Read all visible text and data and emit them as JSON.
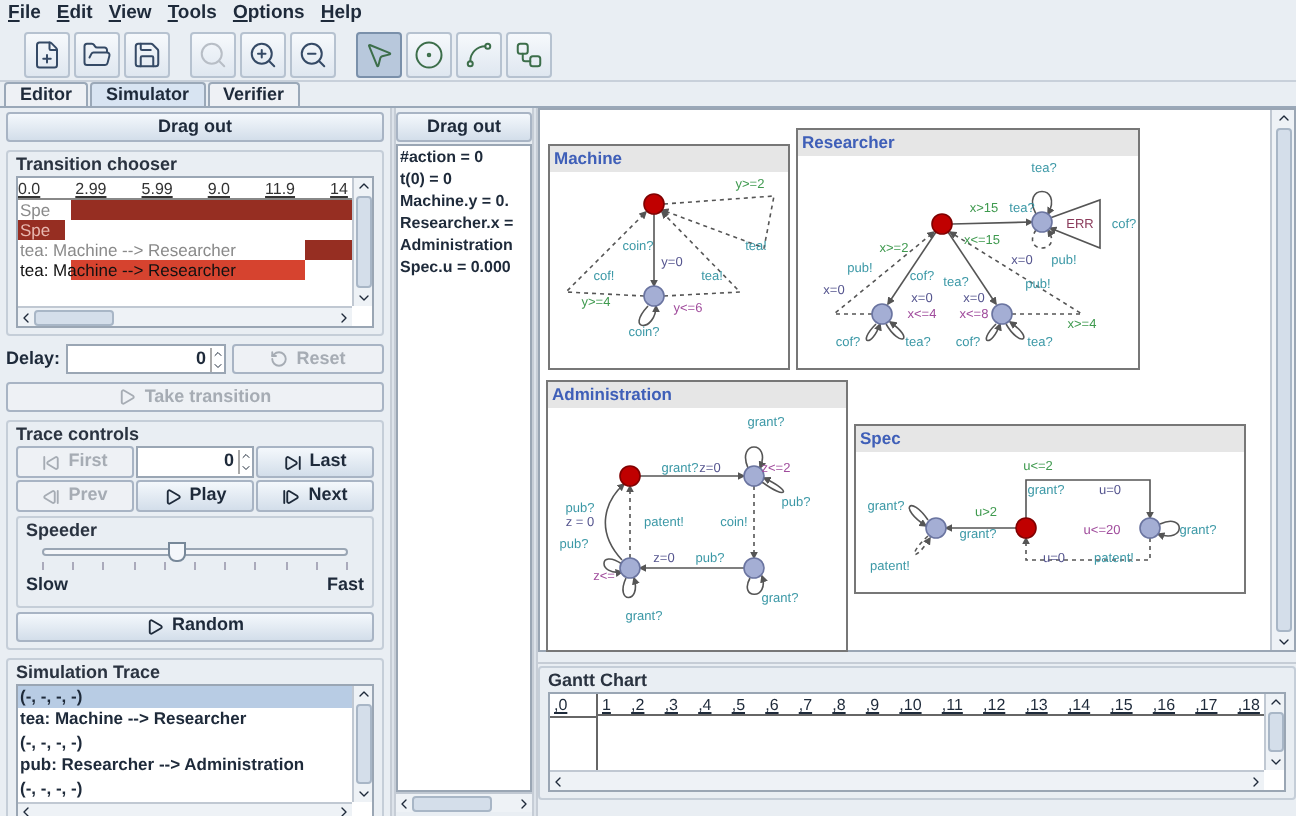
{
  "menu": [
    "File",
    "Edit",
    "View",
    "Tools",
    "Options",
    "Help"
  ],
  "tools": [
    {
      "kind": "new",
      "selected": false,
      "disabled": false
    },
    {
      "kind": "open",
      "selected": false,
      "disabled": false
    },
    {
      "kind": "save",
      "selected": false,
      "disabled": false
    },
    {
      "kind": "zoom-fit",
      "selected": false,
      "disabled": true
    },
    {
      "kind": "zoom-in",
      "selected": false,
      "disabled": false
    },
    {
      "kind": "zoom-out",
      "selected": false,
      "disabled": false
    },
    {
      "kind": "select",
      "selected": true,
      "disabled": false
    },
    {
      "kind": "location",
      "selected": false,
      "disabled": false
    },
    {
      "kind": "nail",
      "selected": false,
      "disabled": false
    },
    {
      "kind": "edge",
      "selected": false,
      "disabled": false
    }
  ],
  "tabs": [
    {
      "label": "Editor",
      "selected": false
    },
    {
      "label": "Simulator",
      "selected": true
    },
    {
      "label": "Verifier",
      "selected": false
    }
  ],
  "left_panel": {
    "drag_out": "Drag out",
    "transition_chooser": {
      "title": "Transition chooser",
      "ticks": [
        "0.0",
        "2.99",
        "5.99",
        "9.0",
        "11.9",
        "14"
      ],
      "rows": [
        {
          "text": "Spe",
          "enabled": false,
          "selected": false
        },
        {
          "text": "Spe",
          "enabled": false,
          "selected": false
        },
        {
          "text": "tea: Machine --> Researcher",
          "enabled": false,
          "selected": false
        },
        {
          "text": "tea: Machine --> Researcher",
          "enabled": true,
          "selected": true
        }
      ]
    },
    "delay": {
      "label": "Delay:",
      "value": "0"
    },
    "reset": {
      "label": "Reset",
      "disabled": true
    },
    "take_transition": {
      "label": "Take transition",
      "disabled": true
    },
    "trace_controls": {
      "title": "Trace controls",
      "step": "0",
      "buttons": [
        {
          "label": "First",
          "kind": "first",
          "disabled": true
        },
        {
          "label": "Last",
          "kind": "last",
          "disabled": false
        },
        {
          "label": "Prev",
          "kind": "prev",
          "disabled": true
        },
        {
          "label": "Play",
          "kind": "play",
          "disabled": false
        },
        {
          "label": "Next",
          "kind": "next",
          "disabled": false
        }
      ]
    },
    "speeder": {
      "title": "Speeder",
      "level": 0.44,
      "min_label": "Slow",
      "max_label": "Fast"
    },
    "random": "Random",
    "simulation_trace": {
      "title": "Simulation Trace",
      "rows": [
        {
          "text": "(-, -, -, -)",
          "selected": true
        },
        {
          "text": "tea: Machine --> Researcher",
          "selected": false
        },
        {
          "text": "(-, -, -, -)",
          "selected": false
        },
        {
          "text": "pub: Researcher --> Administration",
          "selected": false
        },
        {
          "text": "(-, -, -, -)",
          "selected": false
        }
      ]
    }
  },
  "variables_panel": {
    "drag_out": "Drag out",
    "lines": [
      "#action = 0",
      "t(0) = 0",
      "Machine.y = 0.",
      "Researcher.x =",
      "Administration",
      "Spec.u = 0.000"
    ]
  },
  "processes": [
    {
      "name": "Machine",
      "locations": [
        {
          "current": true
        },
        {
          "current": false
        }
      ],
      "labels": [
        {
          "text": "y>=2",
          "kind": "guard"
        },
        {
          "text": "tea!",
          "kind": "sync"
        },
        {
          "text": "coin?",
          "kind": "sync"
        },
        {
          "text": "y=0",
          "kind": "update"
        },
        {
          "text": "tea!",
          "kind": "sync"
        },
        {
          "text": "cof!",
          "kind": "sync"
        },
        {
          "text": "y>=4",
          "kind": "guard"
        },
        {
          "text": "y<=6",
          "kind": "invariant"
        },
        {
          "text": "coin?",
          "kind": "sync"
        }
      ]
    },
    {
      "name": "Researcher",
      "locations": [
        {
          "current": true
        },
        {
          "current": false
        },
        {
          "current": false
        },
        {
          "current": false
        }
      ],
      "labels": [
        {
          "text": "tea?",
          "kind": "sync"
        },
        {
          "text": "x>15",
          "kind": "guard"
        },
        {
          "text": "tea?",
          "kind": "sync"
        },
        {
          "text": "ERR",
          "kind": "name"
        },
        {
          "text": "cof?",
          "kind": "sync"
        },
        {
          "text": "x>=2",
          "kind": "guard"
        },
        {
          "text": "x<=15",
          "kind": "guard"
        },
        {
          "text": "pub!",
          "kind": "sync"
        },
        {
          "text": "cof?",
          "kind": "sync"
        },
        {
          "text": "tea?",
          "kind": "sync"
        },
        {
          "text": "x=0",
          "kind": "update"
        },
        {
          "text": "pub!",
          "kind": "sync"
        },
        {
          "text": "pub!",
          "kind": "sync"
        },
        {
          "text": "x=0",
          "kind": "update"
        },
        {
          "text": "x=0",
          "kind": "update"
        },
        {
          "text": "x<=4",
          "kind": "invariant"
        },
        {
          "text": "x=0",
          "kind": "update"
        },
        {
          "text": "x<=8",
          "kind": "invariant"
        },
        {
          "text": "x>=4",
          "kind": "guard"
        },
        {
          "text": "cof?",
          "kind": "sync"
        },
        {
          "text": "tea?",
          "kind": "sync"
        },
        {
          "text": "cof?",
          "kind": "sync"
        },
        {
          "text": "tea?",
          "kind": "sync"
        }
      ]
    },
    {
      "name": "Administration",
      "locations": [
        {
          "current": true
        },
        {
          "current": false
        },
        {
          "current": false
        },
        {
          "current": false
        }
      ],
      "labels": [
        {
          "text": "grant?",
          "kind": "sync"
        },
        {
          "text": "grant?",
          "kind": "sync"
        },
        {
          "text": "z=0",
          "kind": "update"
        },
        {
          "text": "z<=2",
          "kind": "invariant"
        },
        {
          "text": "pub?",
          "kind": "sync"
        },
        {
          "text": "pub?",
          "kind": "sync"
        },
        {
          "text": "z = 0",
          "kind": "update"
        },
        {
          "text": "patent!",
          "kind": "sync"
        },
        {
          "text": "coin!",
          "kind": "sync"
        },
        {
          "text": "pub?",
          "kind": "sync"
        },
        {
          "text": "z=0",
          "kind": "update"
        },
        {
          "text": "pub?",
          "kind": "sync"
        },
        {
          "text": "z<=",
          "kind": "invariant"
        },
        {
          "text": "grant?",
          "kind": "sync"
        },
        {
          "text": "grant?",
          "kind": "sync"
        }
      ]
    },
    {
      "name": "Spec",
      "locations": [
        {
          "current": false
        },
        {
          "current": true
        },
        {
          "current": false
        }
      ],
      "labels": [
        {
          "text": "u<=2",
          "kind": "guard"
        },
        {
          "text": "grant?",
          "kind": "sync"
        },
        {
          "text": "u=0",
          "kind": "update"
        },
        {
          "text": "grant?",
          "kind": "sync"
        },
        {
          "text": "u>2",
          "kind": "guard"
        },
        {
          "text": "grant?",
          "kind": "sync"
        },
        {
          "text": "u<=20",
          "kind": "invariant"
        },
        {
          "text": "grant?",
          "kind": "sync"
        },
        {
          "text": "patent!",
          "kind": "sync"
        },
        {
          "text": "u=0",
          "kind": "update"
        },
        {
          "text": "patent!",
          "kind": "sync"
        }
      ]
    }
  ],
  "gantt": {
    "title": "Gantt Chart",
    "ticks": [
      ",0",
      "1",
      ",2",
      ",3",
      ",4",
      ",5",
      ",6",
      ",7",
      ",8",
      ",9",
      ",10",
      ",11",
      ",12",
      ",13",
      ",14",
      ",15",
      ",16",
      ",17",
      ",18"
    ]
  }
}
